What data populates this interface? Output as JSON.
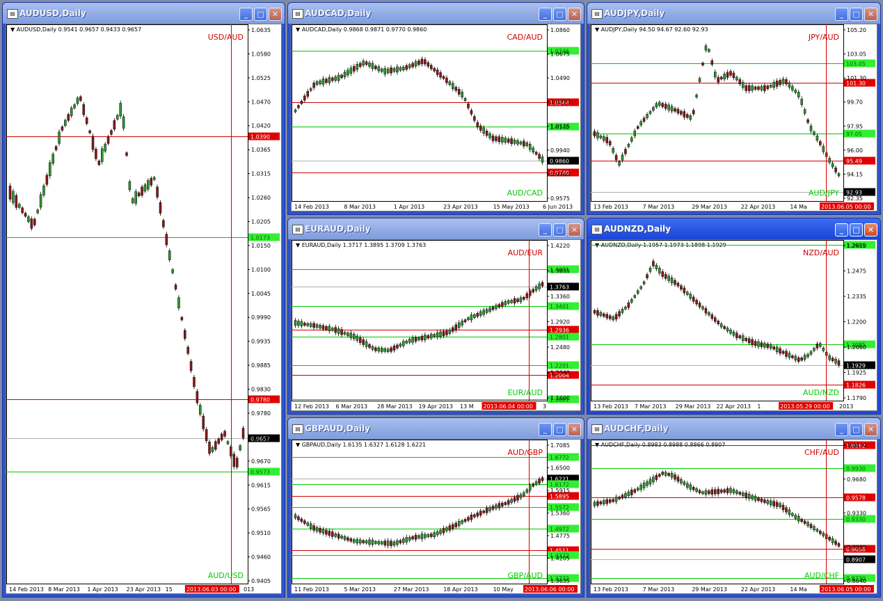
{
  "windows": [
    {
      "id": "audusd",
      "active": false,
      "title": "AUDUSD,Daily",
      "info": "AUDUSD,Daily  0.9541 0.9657 0.9433 0.9657",
      "pair_top": "USD/AUD",
      "pair_bottom": "AUD/USD",
      "y_ticks": [
        "1.0635",
        "1.0580",
        "1.0525",
        "1.0470",
        "1.0420",
        "1.0365",
        "1.0315",
        "1.0260",
        "1.0205",
        "1.0150",
        "1.0100",
        "1.0045",
        "0.9990",
        "0.9935",
        "0.9885",
        "0.9830",
        "0.9780",
        "0.9725",
        "0.9670",
        "0.9615",
        "0.9565",
        "0.9510",
        "0.9460",
        "0.9405"
      ],
      "x_ticks": [
        "14 Feb 2013",
        "8 Mar 2013",
        "1 Apr 2013",
        "23 Apr 2013",
        "15",
        "2013.06.03 00:00",
        "013"
      ],
      "level_labels": [
        {
          "text": "1.0390",
          "kind": "red"
        },
        {
          "text": "1.0173",
          "kind": "green"
        },
        {
          "text": "0.9780",
          "kind": "red"
        },
        {
          "text": "0.9657",
          "kind": "black"
        },
        {
          "text": "0.9573",
          "kind": "green"
        }
      ]
    },
    {
      "id": "audcad",
      "active": false,
      "title": "AUDCAD,Daily",
      "info": "AUDCAD,Daily  0.9868 0.9871 0.9770 0.9860",
      "pair_top": "CAD/AUD",
      "pair_bottom": "AUD/CAD",
      "y_ticks": [
        "1.0860",
        "1.0675",
        "1.0490",
        "1.0310",
        "1.0125",
        "0.9940",
        "0.9760",
        "0.9575"
      ],
      "x_ticks": [
        "14 Feb 2013",
        "8 Mar 2013",
        "1 Apr 2013",
        "23 Apr 2013",
        "15 May 2013",
        "6 Jun 2013"
      ],
      "level_labels": [
        {
          "text": "1.0746",
          "kind": "green"
        },
        {
          "text": "1.0344",
          "kind": "red"
        },
        {
          "text": "1.0146",
          "kind": "green"
        },
        {
          "text": "0.9860",
          "kind": "black"
        },
        {
          "text": "0.9740",
          "kind": "red"
        }
      ]
    },
    {
      "id": "audjpy",
      "active": false,
      "title": "AUDJPY,Daily",
      "info": "AUDJPY,Daily  94.50 94.67 92.60 92.93",
      "pair_top": "JPY/AUD",
      "pair_bottom": "AUD/JPY",
      "y_ticks": [
        "105.20",
        "103.05",
        "101.30",
        "99.70",
        "97.95",
        "96.00",
        "94.15",
        "92.35"
      ],
      "x_ticks": [
        "13 Feb 2013",
        "7 Mar 2013",
        "29 Mar 2013",
        "22 Apr 2013",
        "14 Ma",
        "2013.06.05 00:00"
      ],
      "level_labels": [
        {
          "text": "103.05",
          "kind": "green"
        },
        {
          "text": "101.30",
          "kind": "red"
        },
        {
          "text": "97.05",
          "kind": "green"
        },
        {
          "text": "95.49",
          "kind": "red"
        },
        {
          "text": "92.93",
          "kind": "black"
        }
      ]
    },
    {
      "id": "euraud",
      "active": false,
      "title": "EURAUD,Daily",
      "info": "EURAUD,Daily  1.3717 1.3895 1.3709 1.3763",
      "pair_top": "AUD/EUR",
      "pair_bottom": "EUR/AUD",
      "y_ticks": [
        "1.4220",
        "1.3835",
        "1.3360",
        "1.2920",
        "1.2480",
        "1.2040",
        "1.1600"
      ],
      "x_ticks": [
        "12 Feb 2013",
        "6 Mar 2013",
        "28 Mar 2013",
        "19 Apr 2013",
        "13 M",
        "2013.06.04 00:00",
        "3"
      ],
      "level_labels": [
        {
          "text": "1.4001",
          "kind": "green"
        },
        {
          "text": "1.3763",
          "kind": "black"
        },
        {
          "text": "1.3401",
          "kind": "green"
        },
        {
          "text": "1.2936",
          "kind": "red"
        },
        {
          "text": "1.2801",
          "kind": "green"
        },
        {
          "text": "1.2201",
          "kind": "green"
        },
        {
          "text": "1.2004",
          "kind": "red"
        },
        {
          "text": "1.1601",
          "kind": "green"
        }
      ]
    },
    {
      "id": "audnzd",
      "active": true,
      "title": "AUDNZD,Daily",
      "info": "AUDNZD,Daily  1.1957 1.1973 1.1898 1.1929",
      "pair_top": "NZD/AUD",
      "pair_bottom": "AUD/NZD",
      "y_ticks": [
        "1.2610",
        "1.2475",
        "1.2335",
        "1.2200",
        "1.2060",
        "1.1925",
        "1.1790"
      ],
      "x_ticks": [
        "13 Feb 2013",
        "7 Mar 2013",
        "29 Mar 2013",
        "22 Apr 2013",
        "1",
        "2013.05.29 00:00",
        "2013"
      ],
      "level_labels": [
        {
          "text": "1.2685",
          "kind": "green"
        },
        {
          "text": "1.2085",
          "kind": "green"
        },
        {
          "text": "1.1929",
          "kind": "black"
        },
        {
          "text": "1.1826",
          "kind": "red"
        }
      ]
    },
    {
      "id": "gbpaud",
      "active": false,
      "title": "GBPAUD,Daily",
      "info": "GBPAUD,Daily  1.6135 1.6327 1.6128 1.6221",
      "pair_top": "AUD/GBP",
      "pair_bottom": "GBP/AUD",
      "y_ticks": [
        "1.7085",
        "1.6500",
        "1.5915",
        "1.5360",
        "1.4775",
        "1.4205",
        "1.3635"
      ],
      "x_ticks": [
        "11 Feb 2013",
        "5 Mar 2013",
        "27 Mar 2013",
        "18 Apr 2013",
        "10 May",
        "2013.06.06 00:00"
      ],
      "level_labels": [
        {
          "text": "1.6772",
          "kind": "green"
        },
        {
          "text": "1.6221",
          "kind": "black"
        },
        {
          "text": "1.6172",
          "kind": "green"
        },
        {
          "text": "1.5895",
          "kind": "red"
        },
        {
          "text": "1.5572",
          "kind": "green"
        },
        {
          "text": "1.4972",
          "kind": "green"
        },
        {
          "text": "1.4511",
          "kind": "red"
        },
        {
          "text": "1.4372",
          "kind": "green"
        },
        {
          "text": "1.3772",
          "kind": "green"
        }
      ]
    },
    {
      "id": "audchf",
      "active": false,
      "title": "AUDCHF,Daily",
      "info": "AUDCHF,Daily  0.8983 0.8988 0.8866 0.8907",
      "pair_top": "CHF/AUD",
      "pair_bottom": "AUD/CHF",
      "y_ticks": [
        "1.0030",
        "0.9680",
        "0.9330",
        "0.8985",
        "0.8640"
      ],
      "x_ticks": [
        "13 Feb 2013",
        "7 Mar 2013",
        "29 Mar 2013",
        "22 Apr 2013",
        "14 Ma",
        "2013.06.05 00:00"
      ],
      "level_labels": [
        {
          "text": "1.0162",
          "kind": "red"
        },
        {
          "text": "0.9930",
          "kind": "green"
        },
        {
          "text": "0.9578",
          "kind": "red"
        },
        {
          "text": "0.9330",
          "kind": "green"
        },
        {
          "text": "0.9058",
          "kind": "red"
        },
        {
          "text": "0.8907",
          "kind": "black"
        },
        {
          "text": "0.8730",
          "kind": "green"
        }
      ]
    }
  ],
  "colors": {
    "up": "#2e9a2e",
    "down": "#8b1a1a",
    "green_line": "#00c800",
    "red_line": "#d00000",
    "crosshair": "#d00000",
    "text": "#000000"
  }
}
